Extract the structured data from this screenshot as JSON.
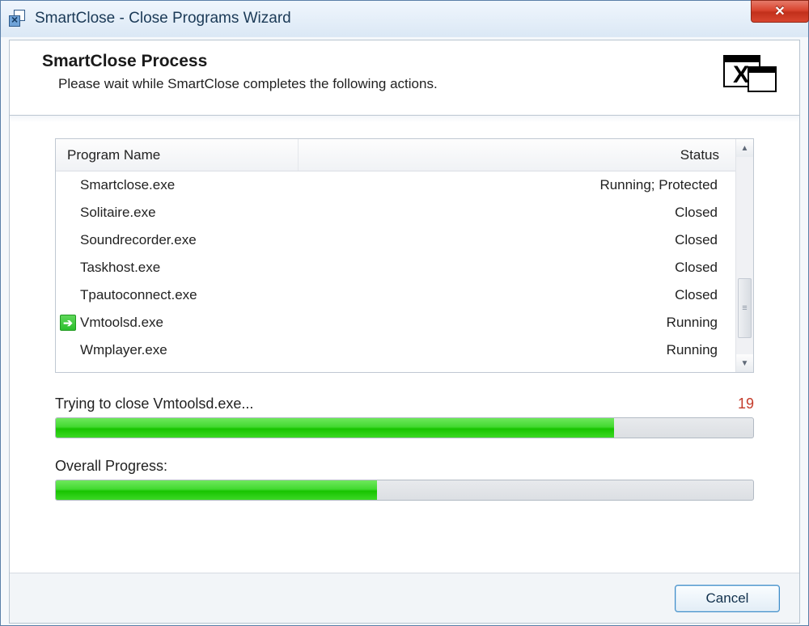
{
  "window": {
    "title": "SmartClose - Close Programs Wizard"
  },
  "header": {
    "title": "SmartClose Process",
    "subtitle": "Please wait while SmartClose completes the following actions."
  },
  "list": {
    "columns": {
      "name": "Program Name",
      "status": "Status"
    },
    "rows": [
      {
        "name": "Smartclose.exe",
        "status": "Running; Protected",
        "active": false
      },
      {
        "name": "Solitaire.exe",
        "status": "Closed",
        "active": false
      },
      {
        "name": "Soundrecorder.exe",
        "status": "Closed",
        "active": false
      },
      {
        "name": "Taskhost.exe",
        "status": "Closed",
        "active": false
      },
      {
        "name": "Tpautoconnect.exe",
        "status": "Closed",
        "active": false
      },
      {
        "name": "Vmtoolsd.exe",
        "status": "Running",
        "active": true
      },
      {
        "name": "Wmplayer.exe",
        "status": "Running",
        "active": false
      }
    ]
  },
  "progress1": {
    "label": "Trying to close Vmtoolsd.exe...",
    "counter": "19",
    "percent": 80
  },
  "progress2": {
    "label": "Overall Progress:",
    "percent": 46
  },
  "footer": {
    "cancel": "Cancel"
  }
}
